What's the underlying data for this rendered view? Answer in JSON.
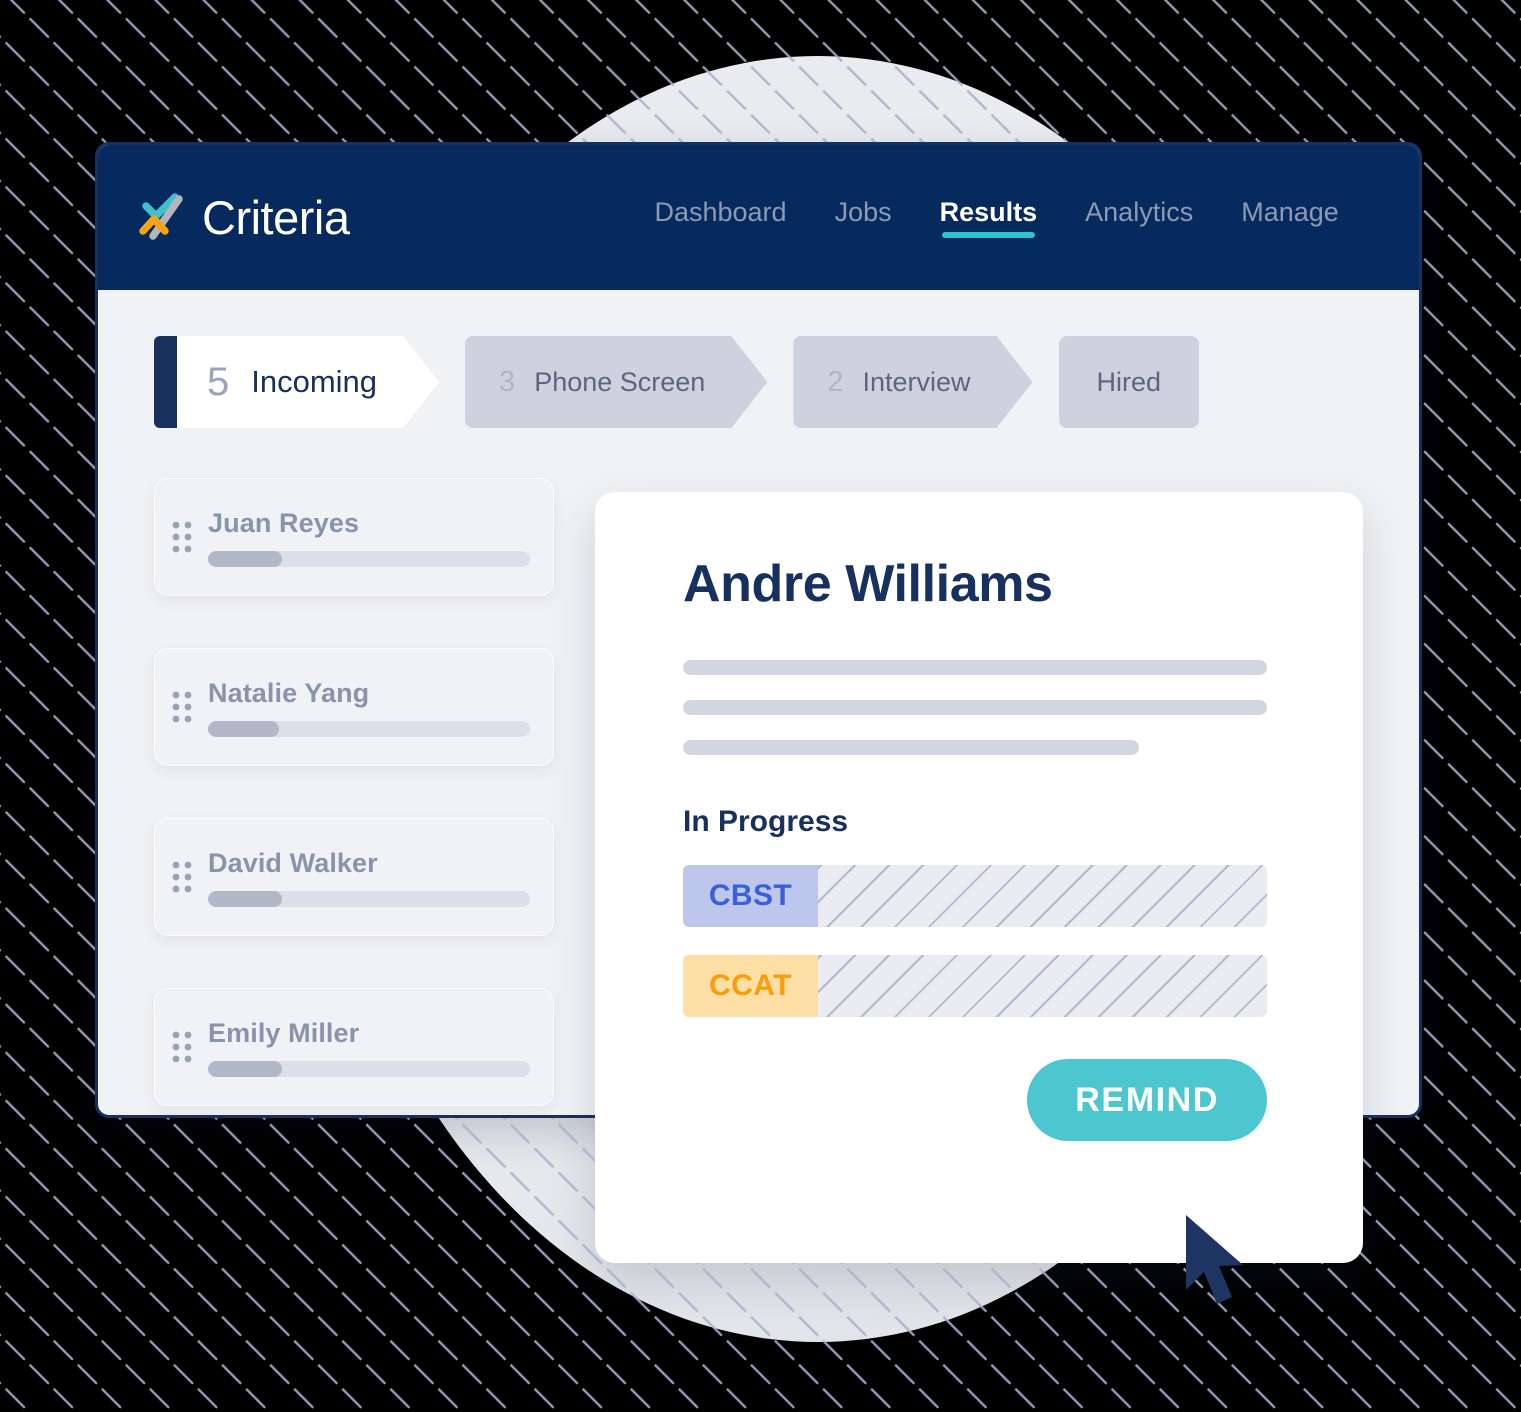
{
  "brand": {
    "name": "Criteria",
    "mark_colors": {
      "teal": "#3fbfd0",
      "orange": "#f7a315",
      "gray": "#b3b6bb"
    }
  },
  "header": {
    "background": "#072a5e",
    "nav": [
      {
        "label": "Dashboard",
        "active": false
      },
      {
        "label": "Jobs",
        "active": false
      },
      {
        "label": "Results",
        "active": true
      },
      {
        "label": "Analytics",
        "active": false
      },
      {
        "label": "Manage",
        "active": false
      }
    ],
    "active_underline_color": "#2ec3ce"
  },
  "pipeline": {
    "stages": [
      {
        "count": "5",
        "label": "Incoming",
        "active": true,
        "shape": "arrow"
      },
      {
        "count": "3",
        "label": "Phone Screen",
        "active": false,
        "shape": "arrow"
      },
      {
        "count": "2",
        "label": "Interview",
        "active": false,
        "shape": "arrow"
      },
      {
        "count": "",
        "label": "Hired",
        "active": false,
        "shape": "rect"
      }
    ]
  },
  "candidates": [
    {
      "name": "Juan Reyes",
      "progress": 23
    },
    {
      "name": "Natalie Yang",
      "progress": 22
    },
    {
      "name": "David Walker",
      "progress": 23
    },
    {
      "name": "Emily Miller",
      "progress": 23
    }
  ],
  "detail": {
    "name": "Andre Williams",
    "skeleton_widths": [
      "100%",
      "100%",
      "78%"
    ],
    "section_title": "In Progress",
    "tests": [
      {
        "code": "CBST",
        "badge_bg": "#bdc7ee",
        "badge_fg": "#3a5fdd"
      },
      {
        "code": "CCAT",
        "badge_bg": "#fddfa5",
        "badge_fg": "#f99d0a"
      }
    ],
    "remind_label": "REMIND",
    "remind_color": "#4cc6cf"
  },
  "colors": {
    "navy": "#17305e",
    "header_navy": "#072a5e",
    "app_body": "#f1f2f5",
    "chip_gray": "#ced2de",
    "hatch_line": "#a8b2cc"
  }
}
